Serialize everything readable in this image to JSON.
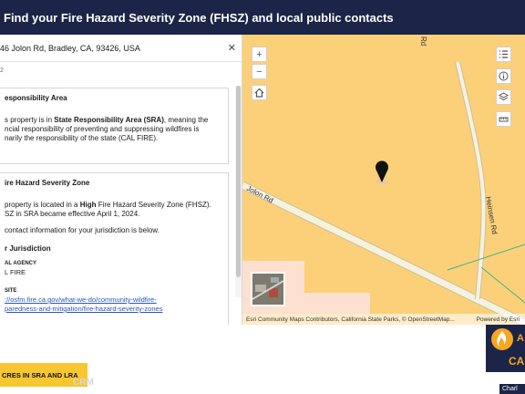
{
  "header": {
    "title": "Find your Fire Hazard Severity Zone (FHSZ) and local public contacts"
  },
  "panel": {
    "address": "46 Jolon Rd, Bradley, CA, 93426, USA",
    "close_glyph": "✕",
    "apn_fragment": "2",
    "card1": {
      "title": "esponsibility Area",
      "line1_pre": "s property is in ",
      "line1_bold": "State Responsibility Area (SRA)",
      "line1_post": ", meaning the",
      "line2": "ncial responsibility of preventing and suppressing wildfires is",
      "line3": "narily the responsibility of the state (CAL FIRE)."
    },
    "card2": {
      "title": "ire Hazard Severity Zone",
      "line1_pre": "property is located in a ",
      "line1_bold": "High",
      "line1_post": " Fire Hazard Severity Zone (FHSZ).",
      "line2": "SZ in SRA became effective April 1, 2024.",
      "line3": "contact information for your jurisdiction is below.",
      "juris_title": "r Jurisdiction",
      "agency_label": "AL AGENCY",
      "agency_value": "L FIRE",
      "website_label": "SITE",
      "website_line1": "://osfm.fire.ca.gov/what-we-do/community-wildfire-",
      "website_line2": "paredness-and-mitigation/fire-hazard-severity-zones"
    }
  },
  "map": {
    "zoom_in": "+",
    "zoom_out": "−",
    "road1": "Jolon Rd",
    "road2": "Heinsen Rd",
    "road3_fragment": "Rd",
    "attribution": "Esri Community Maps Contributors, California State Parks, © OpenStreetMap...",
    "powered_by": "Powered by Esri",
    "colors": {
      "high_zone": "#fcd079",
      "moderate_zone": "#fde0cf",
      "road": "#f5f0d8"
    }
  },
  "footer": {
    "banner_text": "CRES IN SRA AND LRA",
    "watermark": "CRM",
    "logo_letters": "A",
    "logo_letters2": "CA",
    "charl_text": "Charl"
  }
}
